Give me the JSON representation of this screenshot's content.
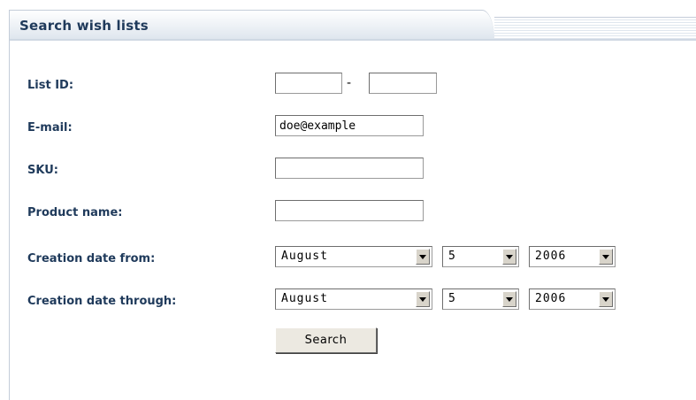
{
  "panel": {
    "title": "Search wish lists"
  },
  "form": {
    "list_id": {
      "label": "List ID:",
      "from_value": "",
      "to_value": "",
      "separator": "-"
    },
    "email": {
      "label": "E-mail:",
      "value": "doe@example"
    },
    "sku": {
      "label": "SKU:",
      "value": ""
    },
    "product_name": {
      "label": "Product name:",
      "value": ""
    },
    "date_from": {
      "label": "Creation date from:",
      "month": "August",
      "day": "5",
      "year": "2006"
    },
    "date_through": {
      "label": "Creation date through:",
      "month": "August",
      "day": "5",
      "year": "2006"
    },
    "search_label": "Search"
  },
  "colors": {
    "label_text": "#1f3a5b",
    "tab_border": "#c4cdd9",
    "button_face": "#ece9e1"
  },
  "icons": {
    "dropdown": "chevron-down-icon"
  }
}
